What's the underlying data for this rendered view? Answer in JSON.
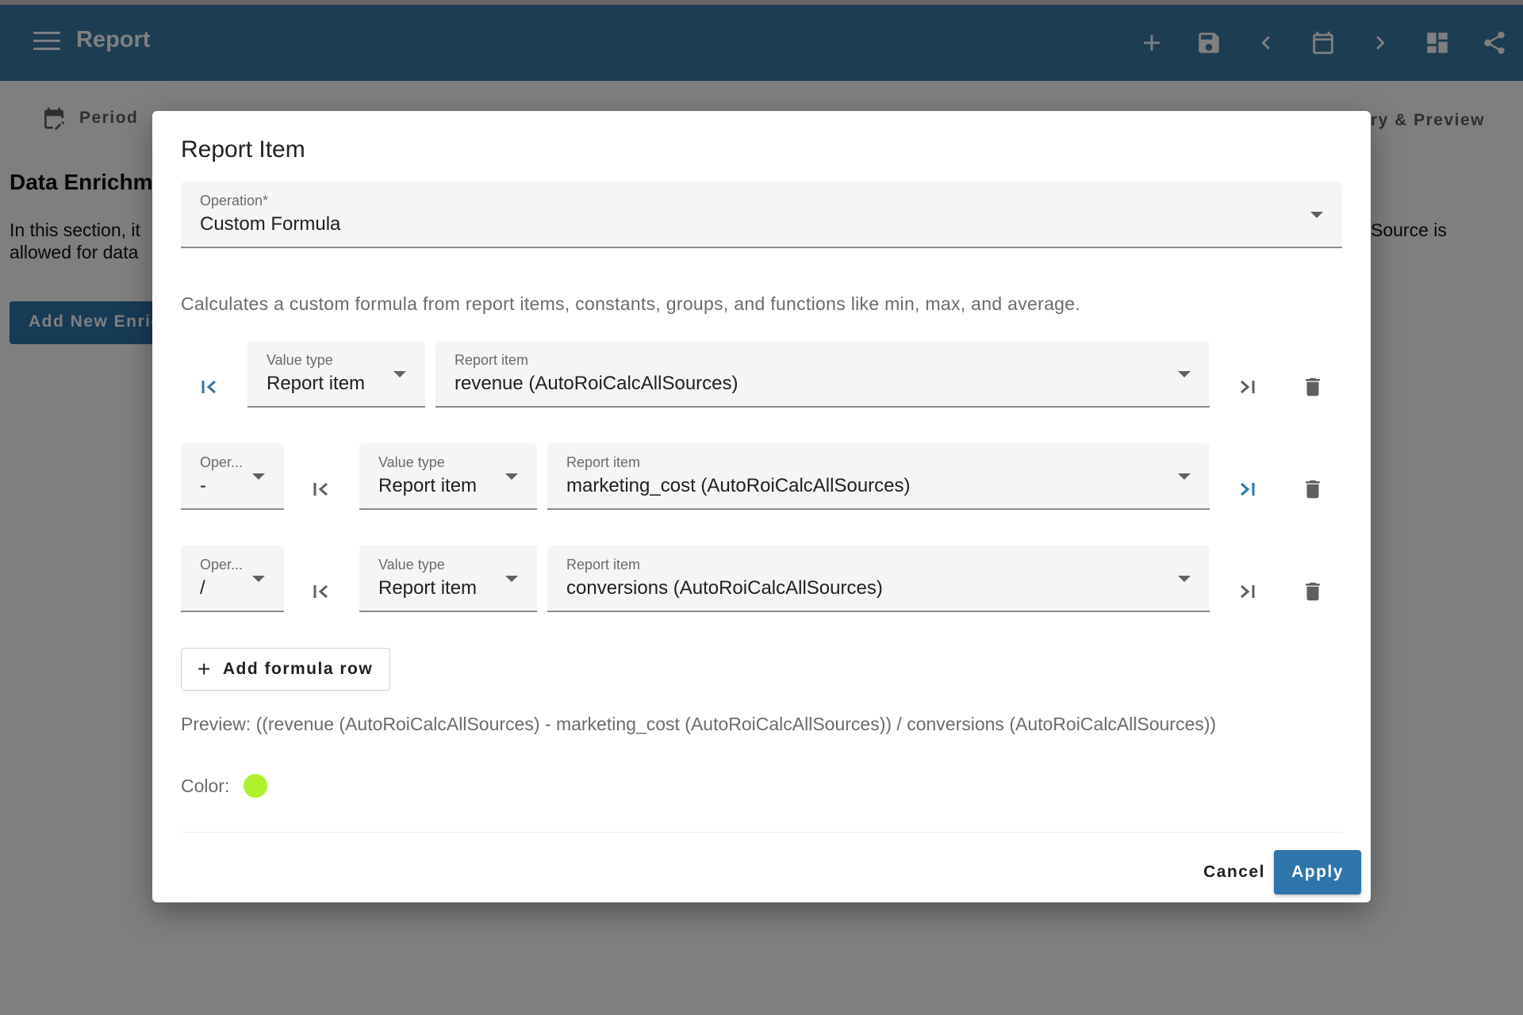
{
  "appbar": {
    "title": "Report",
    "actions": [
      "add-icon",
      "save-icon",
      "chevron-left-icon",
      "calendar-icon",
      "chevron-right-icon",
      "dashboard-icon",
      "share-icon"
    ]
  },
  "tabs": {
    "period": "Period",
    "summary": "ry & Preview"
  },
  "content": {
    "title": "Data Enrichme",
    "text_line1": "In this section, it",
    "text_line2": "allowed for data",
    "text_right": "Source is",
    "add_button": "Add New Enric"
  },
  "dialog": {
    "title": "Report Item",
    "operation": {
      "label": "Operation*",
      "value": "Custom Formula"
    },
    "description": "Calculates a custom formula from report items, constants, groups, and functions like min, max, and average.",
    "rows": [
      {
        "operator": null,
        "value_type_label": "Value type",
        "value_type": "Report item",
        "item_label": "Report item",
        "item": "revenue (AutoRoiCalcAllSources)",
        "close_paren_active": false
      },
      {
        "operator_label": "Oper...",
        "operator": "-",
        "value_type_label": "Value type",
        "value_type": "Report item",
        "item_label": "Report item",
        "item": "marketing_cost (AutoRoiCalcAllSources)",
        "close_paren_active": true
      },
      {
        "operator_label": "Oper...",
        "operator": "/",
        "value_type_label": "Value type",
        "value_type": "Report item",
        "item_label": "Report item",
        "item": "conversions (AutoRoiCalcAllSources)",
        "close_paren_active": false
      }
    ],
    "add_row_label": "Add formula row",
    "preview": "Preview: ((revenue (AutoRoiCalcAllSources) - marketing_cost (AutoRoiCalcAllSources)) / conversions (AutoRoiCalcAllSources))",
    "color_label": "Color:",
    "color_value": "#aef12c",
    "cancel_label": "Cancel",
    "apply_label": "Apply"
  },
  "colors": {
    "appbar": "#3a7aa6",
    "primary": "#2e75ab",
    "active_icon": "#2e75ab"
  }
}
